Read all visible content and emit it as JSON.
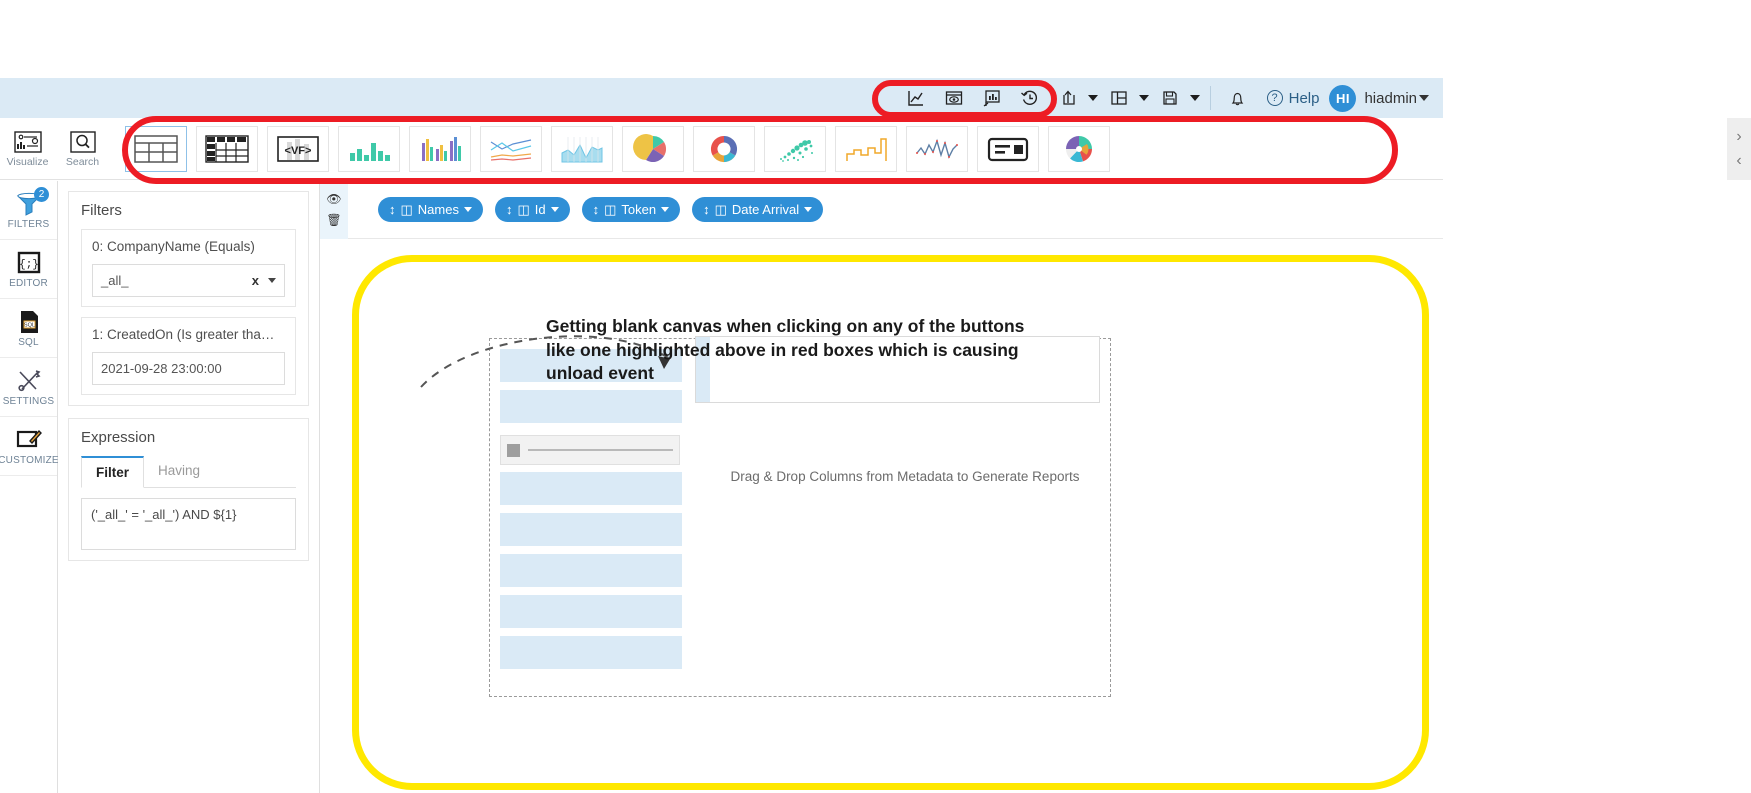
{
  "topbar": {
    "tools": [
      {
        "name": "chart-line-icon",
        "title": "Chart"
      },
      {
        "name": "preview-eye-icon",
        "title": "Preview"
      },
      {
        "name": "presentation-chart-icon",
        "title": "Presentation"
      },
      {
        "name": "history-clock-icon",
        "title": "History"
      }
    ],
    "menus": [
      {
        "name": "export-icon",
        "title": "Export"
      },
      {
        "name": "layout-icon",
        "title": "Layout"
      },
      {
        "name": "save-icon",
        "title": "Save"
      }
    ],
    "notification_label": "notification-bell-icon",
    "help_label": "Help",
    "avatar_initials": "HI",
    "user_name": "hiadmin",
    "accent_color": "#2f8fd6",
    "bar_color": "#dbeaf5"
  },
  "rail_top": [
    {
      "label": "Visualize",
      "icon": "visualize-icon"
    },
    {
      "label": "Search",
      "icon": "search-icon"
    }
  ],
  "chart_types": [
    {
      "name": "table-chart",
      "selected": true
    },
    {
      "name": "pivot-table-chart",
      "selected": false
    },
    {
      "name": "vf-code-chart",
      "selected": false
    },
    {
      "name": "bar-chart",
      "selected": false
    },
    {
      "name": "column-chart",
      "selected": false
    },
    {
      "name": "line-chart",
      "selected": false
    },
    {
      "name": "area-chart",
      "selected": false
    },
    {
      "name": "pie-chart",
      "selected": false
    },
    {
      "name": "donut-chart",
      "selected": false
    },
    {
      "name": "scatter-chart",
      "selected": false
    },
    {
      "name": "step-chart",
      "selected": false
    },
    {
      "name": "spline-chart",
      "selected": false
    },
    {
      "name": "kpi-card-chart",
      "selected": false
    },
    {
      "name": "sunburst-chart",
      "selected": false
    }
  ],
  "strip_arrows": {
    "next": "›",
    "prev": "‹"
  },
  "sidebar": {
    "items": [
      {
        "label": "FILTERS",
        "icon": "filter-funnel-icon",
        "badge": "2"
      },
      {
        "label": "EDITOR",
        "icon": "code-braces-icon",
        "badge": null
      },
      {
        "label": "SQL",
        "icon": "sql-file-icon",
        "badge": null
      },
      {
        "label": "SETTINGS",
        "icon": "tools-cross-icon",
        "badge": null
      },
      {
        "label": "CUSTOMIZE",
        "icon": "customize-pencil-icon",
        "badge": null
      }
    ]
  },
  "filters_panel": {
    "title": "Filters",
    "filters": [
      {
        "label": "0: CompanyName (Equals)",
        "value": "_all_",
        "clear": "x",
        "has_dropdown": true
      },
      {
        "label": "1: CreatedOn (Is greater tha…",
        "value": "2021-09-28 23:00:00",
        "clear": "",
        "has_dropdown": false
      }
    ],
    "expression": {
      "title": "Expression",
      "tabs": [
        {
          "label": "Filter",
          "active": true
        },
        {
          "label": "Having",
          "active": false
        }
      ],
      "value": "('_all_' = '_all_') AND ${1}"
    }
  },
  "main": {
    "column_pills": [
      {
        "label": "Names"
      },
      {
        "label": "Id"
      },
      {
        "label": "Token"
      },
      {
        "label": "Date Arrival"
      }
    ],
    "pill_icons": {
      "sort": "sort-updown-icon",
      "column": "column-icon",
      "caret": "chevron-down-icon"
    },
    "side_icons": [
      {
        "name": "hide-eye-icon"
      },
      {
        "name": "delete-trash-icon"
      }
    ],
    "drop_hint": "Drag & Drop Columns from Metadata to Generate Reports",
    "annotation": "Getting blank canvas when clicking on any of the buttons like one highlighted above in red boxes which is causing unload event"
  },
  "annotations": {
    "red_color": "#ed1c24",
    "yellow_color": "#ffe800",
    "red_boxes": [
      "chart-type-strip",
      "top-toolbar-tools"
    ],
    "yellow_box": "blank-canvas-area"
  }
}
